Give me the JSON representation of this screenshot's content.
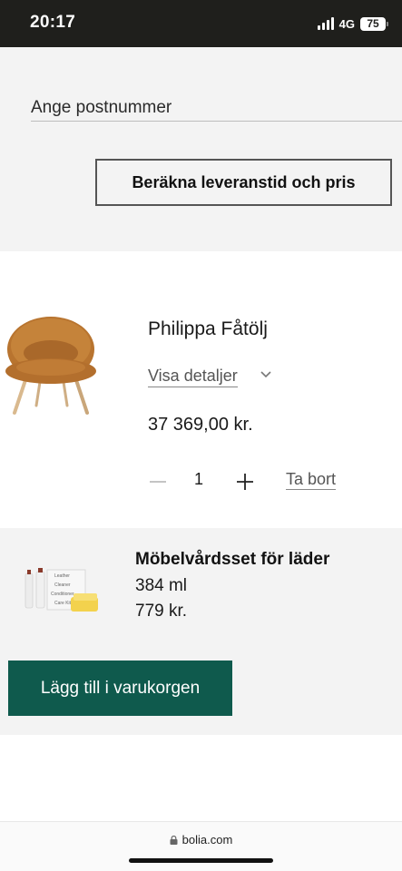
{
  "status": {
    "time": "20:17",
    "network": "4G",
    "battery": "75"
  },
  "postcode": {
    "placeholder": "Ange postnummer",
    "calculate_label": "Beräkna leveranstid och pris"
  },
  "product": {
    "name": "Philippa Fåtölj",
    "details_label": "Visa detaljer",
    "price": "37 369,00 kr.",
    "quantity": "1",
    "remove_label": "Ta bort"
  },
  "upsell": {
    "name": "Möbelvårdsset för läder",
    "size": "384 ml",
    "price": "779 kr.",
    "kit_labels": [
      "Leather",
      "Cleaner",
      "Conditioner",
      "Care Kit"
    ],
    "add_label": "Lägg till i varukorgen"
  },
  "browser": {
    "url": "bolia.com"
  },
  "colors": {
    "accent": "#0f5a4d",
    "section_bg": "#f3f3f3",
    "chair": "#b8742f"
  },
  "icons": [
    "signal-icon",
    "battery-icon",
    "chevron-down-icon",
    "minus-icon",
    "plus-icon",
    "lock-icon"
  ]
}
